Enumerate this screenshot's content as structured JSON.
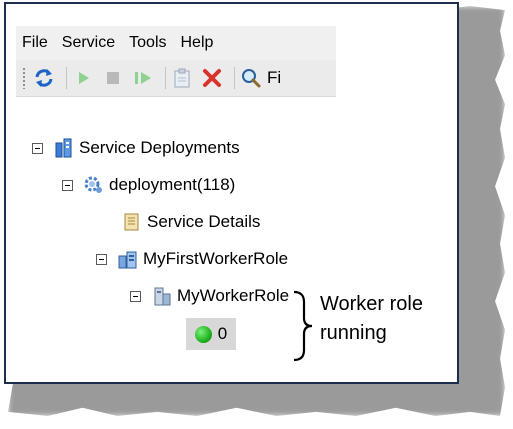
{
  "menubar": {
    "items": [
      "File",
      "Service",
      "Tools",
      "Help"
    ]
  },
  "toolbar": {
    "buttons": [
      "refresh-icon",
      "run-icon",
      "stop-icon",
      "step-icon",
      "clipboard-icon",
      "delete-icon",
      "search-icon"
    ],
    "search_text": "Fi"
  },
  "tree": {
    "root_label": "Service Deployments",
    "deployment_label": "deployment(118)",
    "service_details_label": "Service Details",
    "role_label": "MyFirstWorkerRole",
    "worker_label": "MyWorkerRole",
    "instance_count": "0"
  },
  "annotation": {
    "line1": "Worker role",
    "line2": "running"
  },
  "colors": {
    "frame_border": "#1f2d4d",
    "running_status": "#1fb21f",
    "delete": "#d9342b"
  }
}
